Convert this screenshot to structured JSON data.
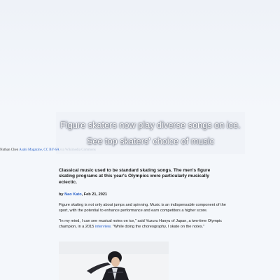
{
  "hero": {
    "title": "Figure skaters now play diverse songs on ice.",
    "subtitle": "See top skaters' choice of music"
  },
  "credit": {
    "name": "Nathan Chen",
    "source": "Asahi Magazine, CC BY-SA",
    "via": "via Wikimedia Commons"
  },
  "article": {
    "lede": "Classical music used to be standard skating songs. The men's figure skating programs at this year's Olympics were particularly musically eclectic.",
    "byline_prefix": "by",
    "author": "Nao Kato",
    "date": ", Feb 21, 2021",
    "para1": "Figure skating is not only about jumps and spinning. Music is an indispensable component of the sport, with the potential to enhance performance and earn competitors a higher score.",
    "para2_before": "\"In my mind, I can see musical notes on ice,\" said Yuzuru Hanyu of Japan, a two-time Olympic champion, in a 2015",
    "para2_link": "interview",
    "para2_after": ". \"While doing the choreography, I skate on the notes.\""
  },
  "colors": {
    "link": "#2b62c9",
    "text": "#1a1a1a",
    "background": "#f4f7fb"
  }
}
